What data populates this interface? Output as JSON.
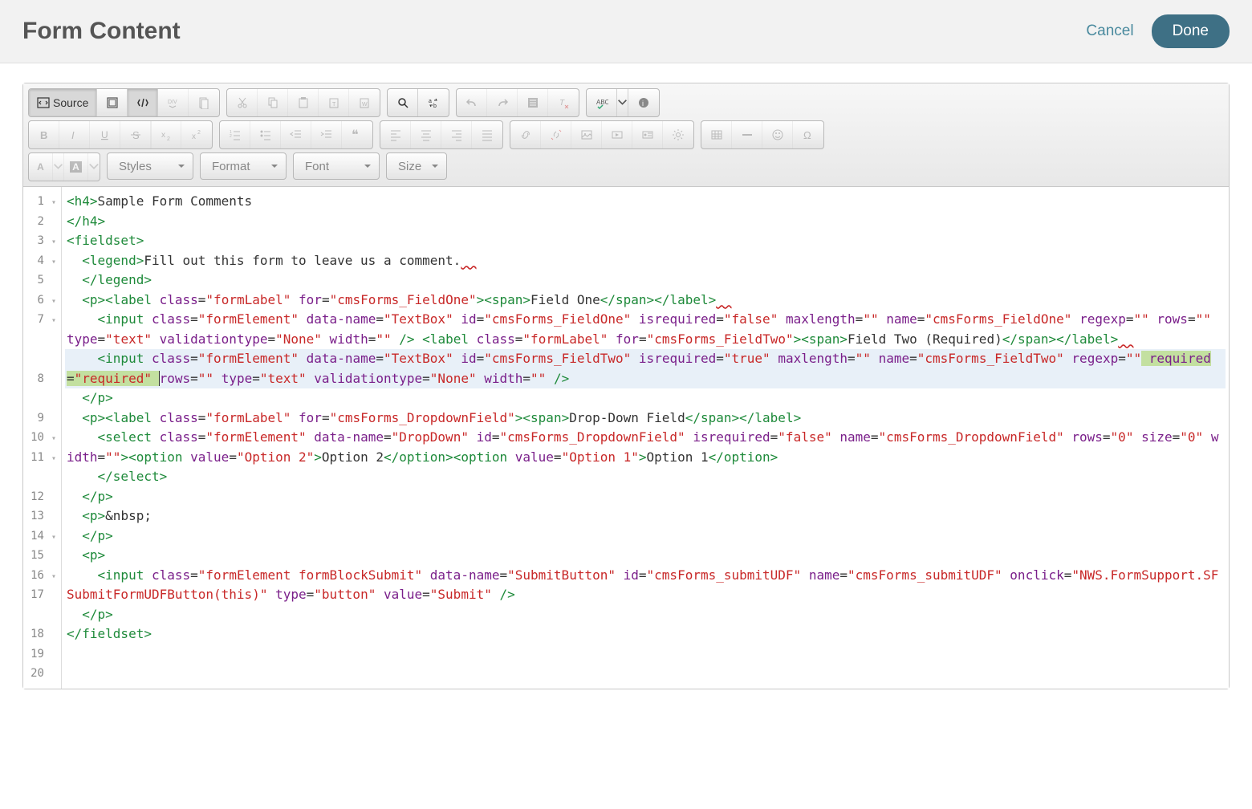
{
  "header": {
    "title": "Form Content",
    "cancel": "Cancel",
    "done": "Done"
  },
  "toolbar": {
    "source": "Source",
    "styles": "Styles",
    "format": "Format",
    "font": "Font",
    "size": "Size"
  },
  "icons": {
    "source": "source-icon",
    "templates": "templates-icon",
    "showblocks": "show-blocks-icon",
    "div": "div-icon",
    "newpage": "new-page-icon",
    "cut": "cut-icon",
    "copy": "copy-icon",
    "paste": "paste-icon",
    "pastetxt": "paste-text-icon",
    "pasteword": "paste-word-icon",
    "find": "find-icon",
    "replace": "replace-icon",
    "undo": "undo-icon",
    "redo": "redo-icon",
    "removeformat": "remove-format-icon",
    "selectall": "select-all-icon",
    "spell": "spellcheck-icon",
    "about": "about-icon",
    "bold": "bold-icon",
    "italic": "italic-icon",
    "underline": "underline-icon",
    "strike": "strike-icon",
    "sub": "subscript-icon",
    "sup": "superscript-icon",
    "ol": "numbered-list-icon",
    "ul": "bulleted-list-icon",
    "outdent": "outdent-icon",
    "indent": "indent-icon",
    "quote": "blockquote-icon",
    "left": "align-left-icon",
    "center": "align-center-icon",
    "right": "align-right-icon",
    "justify": "align-justify-icon",
    "link": "link-icon",
    "unlink": "unlink-icon",
    "image": "image-icon",
    "video": "video-icon",
    "card": "card-icon",
    "gear": "gear-icon",
    "table": "table-icon",
    "hr": "hr-icon",
    "smiley": "smiley-icon",
    "special": "special-char-icon",
    "textcolor": "text-color-icon",
    "bgcolor": "bg-color-icon"
  },
  "gutter": [
    {
      "n": "1",
      "f": true
    },
    {
      "n": "2",
      "f": false
    },
    {
      "n": "3",
      "f": true
    },
    {
      "n": "4",
      "f": true
    },
    {
      "n": "5",
      "f": false
    },
    {
      "n": "6",
      "f": true
    },
    {
      "n": "7",
      "f": true
    },
    {
      "n": "8",
      "f": false
    },
    {
      "n": "9",
      "f": false
    },
    {
      "n": "10",
      "f": true
    },
    {
      "n": "11",
      "f": true
    },
    {
      "n": "12",
      "f": false
    },
    {
      "n": "13",
      "f": false
    },
    {
      "n": "14",
      "f": true
    },
    {
      "n": "15",
      "f": false
    },
    {
      "n": "16",
      "f": true
    },
    {
      "n": "17",
      "f": false
    },
    {
      "n": "18",
      "f": false
    },
    {
      "n": "19",
      "f": false
    },
    {
      "n": "20",
      "f": false
    }
  ],
  "code": {
    "l1": {
      "a": "<h4>",
      "b": "Sample Form Comments"
    },
    "l2": "</h4>",
    "l3": "<fieldset>",
    "l4": {
      "a": "<legend>",
      "b": "Fill out this form to leave us a comment.",
      "sq": "  "
    },
    "l5": "</legend>",
    "l6": {
      "pre": "  ",
      "a": "<p><label ",
      "attr1": "class",
      "v1": "\"formLabel\"",
      "attr2": "for",
      "v2": "\"cmsForms_FieldOne\"",
      "b": "><span>",
      "txt": "Field One",
      "c": "</span></label>",
      "sq": "  "
    },
    "l7": {
      "pre": "    ",
      "a": "<input ",
      "attrs": [
        [
          "class",
          "\"formElement\""
        ],
        [
          "data-name",
          "\"TextBox\""
        ],
        [
          "id",
          "\"cmsForms_FieldOne\""
        ],
        [
          "isrequired",
          "\"false\""
        ],
        [
          "maxlength",
          "\"\""
        ]
      ],
      "wrap_attrs": [
        [
          "name",
          "\"cmsForms_FieldOne\""
        ],
        [
          "regexp",
          "\"\""
        ],
        [
          "rows",
          "\"\""
        ],
        [
          "type",
          "\"text\""
        ],
        [
          "validationtype",
          "\"None\""
        ],
        [
          "width",
          "\"\""
        ]
      ],
      "mid": " /> ",
      "b": "<label ",
      "attrs2": [
        [
          "class",
          "\"formLabel\""
        ],
        [
          "for",
          "\"cmsForms_FieldTwo\""
        ]
      ],
      "c": "><span>",
      "txt": "Field Two (Required)",
      "d": "</span></label>",
      "sq": "  "
    },
    "l8": {
      "pre": "    ",
      "a": "<input ",
      "attrs": [
        [
          "class",
          "\"formElement\""
        ],
        [
          "data-name",
          "\"TextBox\""
        ],
        [
          "id",
          "\"cmsForms_FieldTwo\""
        ],
        [
          "isrequired",
          "\"true\""
        ],
        [
          "maxlength",
          "\"\""
        ],
        [
          "name",
          "\"cmsForms_FieldTwo\""
        ]
      ],
      "wrap_pre_attr": [
        "regexp",
        "\"\""
      ],
      "hl_text": " required=\"required\" ",
      "post_attrs": [
        [
          "rows",
          "\"\""
        ],
        [
          "type",
          "\"text\""
        ],
        [
          "validationtype",
          "\"None\""
        ],
        [
          "width",
          "\"\""
        ]
      ],
      "end": " />"
    },
    "l9": "  </p>",
    "l10": {
      "pre": "  ",
      "a": "<p><label ",
      "attrs": [
        [
          "class",
          "\"formLabel\""
        ],
        [
          "for",
          "\"cmsForms_DropdownField\""
        ]
      ],
      "b": "><span>",
      "txt": "Drop-Down Field",
      "c": "</span></label>"
    },
    "l11": {
      "pre": "    ",
      "a": "<select ",
      "attrs": [
        [
          "class",
          "\"formElement\""
        ],
        [
          "data-name",
          "\"DropDown\""
        ],
        [
          "id",
          "\"cmsForms_DropdownField\""
        ],
        [
          "isrequired",
          "\"false\""
        ],
        [
          "name",
          "\"cmsForms_DropdownField\""
        ]
      ],
      "wrap_attrs": [
        [
          "rows",
          "\"0\""
        ],
        [
          "size",
          "\"0\""
        ],
        [
          "width",
          "\"\""
        ]
      ],
      "b": "><option ",
      "oattr": [
        "value",
        "\"Option 2\""
      ],
      "ob": ">",
      "ot1": "Option 2",
      "oc": "</option><option ",
      "oattr2": [
        "value",
        "\"Option 1\""
      ],
      "ob2": ">",
      "ot2": "Option 1",
      "oc2": "</option>"
    },
    "l12": "    </select>",
    "l13": "  </p>",
    "l14": {
      "pre": "  ",
      "a": "<p>",
      "b": "&nbsp;"
    },
    "l15": "  </p>",
    "l16": "  <p>",
    "l17": {
      "pre": "    ",
      "a": "<input ",
      "attrs": [
        [
          "class",
          "\"formElement formBlockSubmit\""
        ],
        [
          "data-name",
          "\"SubmitButton\""
        ],
        [
          "id",
          "\"cmsForms_submitUDF\""
        ],
        [
          "name",
          "\"cmsForms_submitUDF\""
        ]
      ],
      "wrap_attrs": [
        [
          "onclick",
          "\"NWS.FormSupport.SFSubmitFormUDFButton(this)\""
        ],
        [
          "type",
          "\"button\""
        ],
        [
          "value",
          "\"Submit\""
        ]
      ],
      "end": " />"
    },
    "l18": "  </p>",
    "l19": "</fieldset>",
    "l20": ""
  }
}
